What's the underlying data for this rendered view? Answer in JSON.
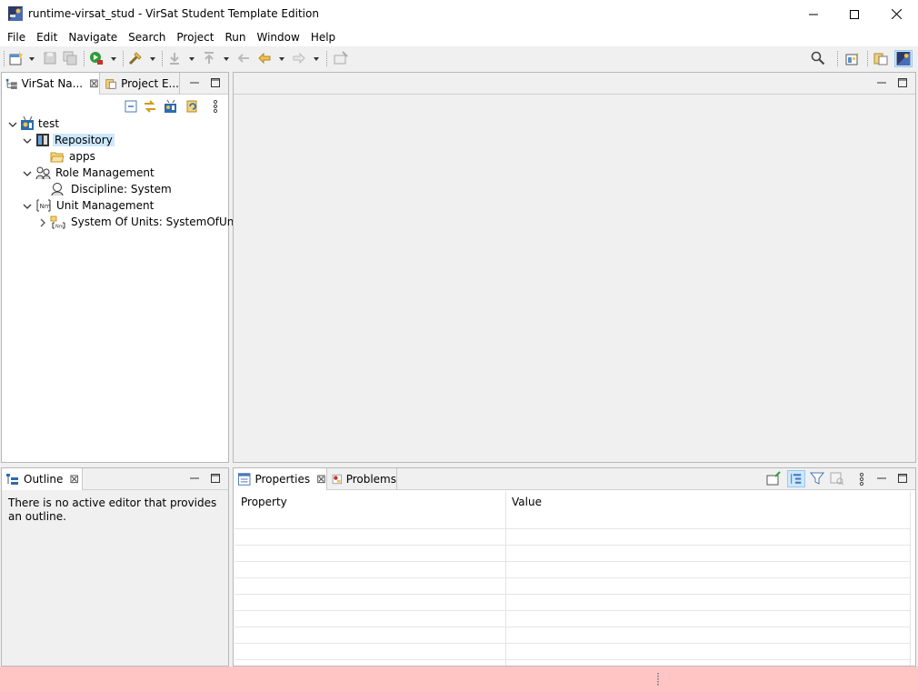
{
  "window": {
    "title": "runtime-virsat_stud - VirSat Student Template Edition",
    "controls": [
      "minimize",
      "maximize",
      "close"
    ]
  },
  "menu": [
    "File",
    "Edit",
    "Navigate",
    "Search",
    "Project",
    "Run",
    "Window",
    "Help"
  ],
  "toolbar": {
    "icons": [
      "new-icon",
      "save-icon",
      "save-all-icon",
      "run-icon",
      "external-tools-icon",
      "next-annotation-icon",
      "previous-annotation-icon",
      "last-edit-location-icon",
      "back-icon",
      "forward-icon",
      "pin-editor-icon",
      "search-icon",
      "open-perspective-icon",
      "resource-perspective-icon",
      "virsat-perspective-icon"
    ]
  },
  "navigator": {
    "tabs": [
      {
        "label": "VirSat Na...",
        "closable": true,
        "active": true
      },
      {
        "label": "Project E...",
        "closable": false,
        "active": false
      }
    ],
    "tree": [
      {
        "label": "test",
        "level": 0,
        "expanded": true
      },
      {
        "label": "Repository",
        "level": 1,
        "expanded": true,
        "selected": true
      },
      {
        "label": "apps",
        "level": 2
      },
      {
        "label": "Role Management",
        "level": 1,
        "expanded": true
      },
      {
        "label": "Discipline: System",
        "level": 2
      },
      {
        "label": "Unit Management",
        "level": 1,
        "expanded": true
      },
      {
        "label": "System Of Units: SystemOfUnits",
        "level": 2,
        "expanded": false
      }
    ]
  },
  "outline": {
    "tab_label": "Outline",
    "message": "There is no active editor that provides an outline."
  },
  "properties": {
    "tabs": [
      {
        "label": "Properties",
        "active": true
      },
      {
        "label": "Problems",
        "active": false
      }
    ],
    "columns": [
      "Property",
      "Value"
    ]
  },
  "colors": {
    "selection": "#cce8ff",
    "status_bar": "#ffc5c5",
    "chrome": "#f0f0f0"
  }
}
